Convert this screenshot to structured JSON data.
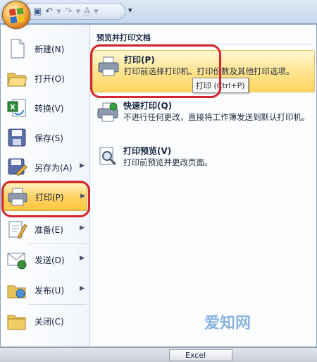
{
  "left_menu": [
    {
      "label": "新建(N)",
      "icon": "new-document-icon",
      "has_submenu": false
    },
    {
      "label": "打开(O)",
      "icon": "open-folder-icon",
      "has_submenu": false
    },
    {
      "label": "转换(V)",
      "icon": "convert-icon",
      "has_submenu": false
    },
    {
      "label": "保存(S)",
      "icon": "save-icon",
      "has_submenu": false
    },
    {
      "label": "另存为(A)",
      "icon": "save-as-icon",
      "has_submenu": true
    },
    {
      "label": "打印(P)",
      "icon": "printer-icon",
      "has_submenu": true,
      "active": true
    },
    {
      "label": "准备(E)",
      "icon": "prepare-icon",
      "has_submenu": true
    },
    {
      "label": "发送(D)",
      "icon": "send-icon",
      "has_submenu": true
    },
    {
      "label": "发布(U)",
      "icon": "publish-icon",
      "has_submenu": true
    },
    {
      "label": "关闭(C)",
      "icon": "close-folder-icon",
      "has_submenu": false
    }
  ],
  "right_pane": {
    "header": "预览并打印文档",
    "options": [
      {
        "title": "打印(P)",
        "desc": "打印前选择打印机、打印份数及其他打印选项。",
        "icon": "printer-icon",
        "highlighted": true
      },
      {
        "title": "快速打印(Q)",
        "desc": "不进行任何更改，直接将工作簿发送到默认打印机。",
        "icon": "quick-print-icon",
        "highlighted": false
      },
      {
        "title": "打印预览(V)",
        "desc": "打印前预览并更改页面。",
        "icon": "print-preview-icon",
        "highlighted": false
      }
    ]
  },
  "tooltip": "打印 (Ctrl+P)",
  "taskbar": {
    "item": "Excel"
  },
  "watermark": "爱知网",
  "colors": {
    "highlight": "#ffd365",
    "annotation": "#d3262e"
  }
}
